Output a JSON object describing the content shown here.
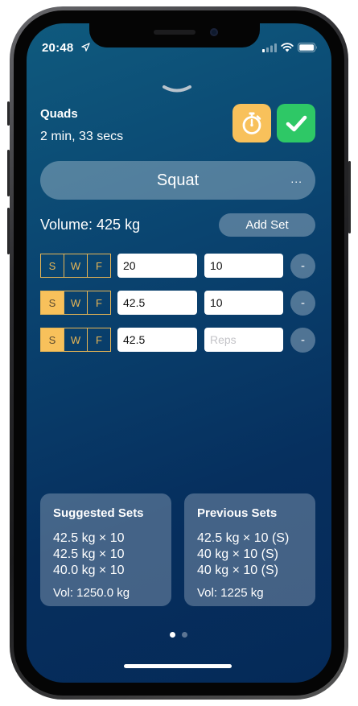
{
  "status_bar": {
    "time": "20:48",
    "icons": [
      "location-arrow-icon",
      "cellular-signal-icon",
      "wifi-icon",
      "battery-icon"
    ]
  },
  "workout": {
    "muscle_group": "Quads",
    "duration": "2 min, 33 secs",
    "timer_icon": "stopwatch-icon",
    "done_icon": "checkmark-icon",
    "exercise_name": "Squat",
    "exercise_more": "...",
    "volume": "Volume: 425 kg",
    "add_set_label": "Add Set"
  },
  "set_type_labels": {
    "s": "S",
    "w": "W",
    "f": "F"
  },
  "sets": [
    {
      "selected_type": "none",
      "weight": "20",
      "reps": "10",
      "reps_placeholder": "Reps",
      "remove_label": "-"
    },
    {
      "selected_type": "S",
      "weight": "42.5",
      "reps": "10",
      "reps_placeholder": "Reps",
      "remove_label": "-"
    },
    {
      "selected_type": "S",
      "weight": "42.5",
      "reps": "",
      "reps_placeholder": "Reps",
      "remove_label": "-"
    }
  ],
  "suggested_sets": {
    "title": "Suggested Sets",
    "lines": [
      "42.5 kg × 10",
      "42.5 kg × 10",
      "40.0 kg × 10"
    ],
    "volume": "Vol: 1250.0 kg"
  },
  "previous_sets": {
    "title": "Previous Sets",
    "lines": [
      "42.5 kg × 10 (S)",
      "40 kg × 10 (S)",
      "40 kg × 10 (S)"
    ],
    "volume": "Vol: 1225 kg"
  },
  "pagination": {
    "total": 2,
    "current": 1
  },
  "colors": {
    "accent_yellow": "#f8c15b",
    "success_green": "#2ec866",
    "background_top": "#0f5a7e",
    "background_bottom": "#052a58"
  }
}
